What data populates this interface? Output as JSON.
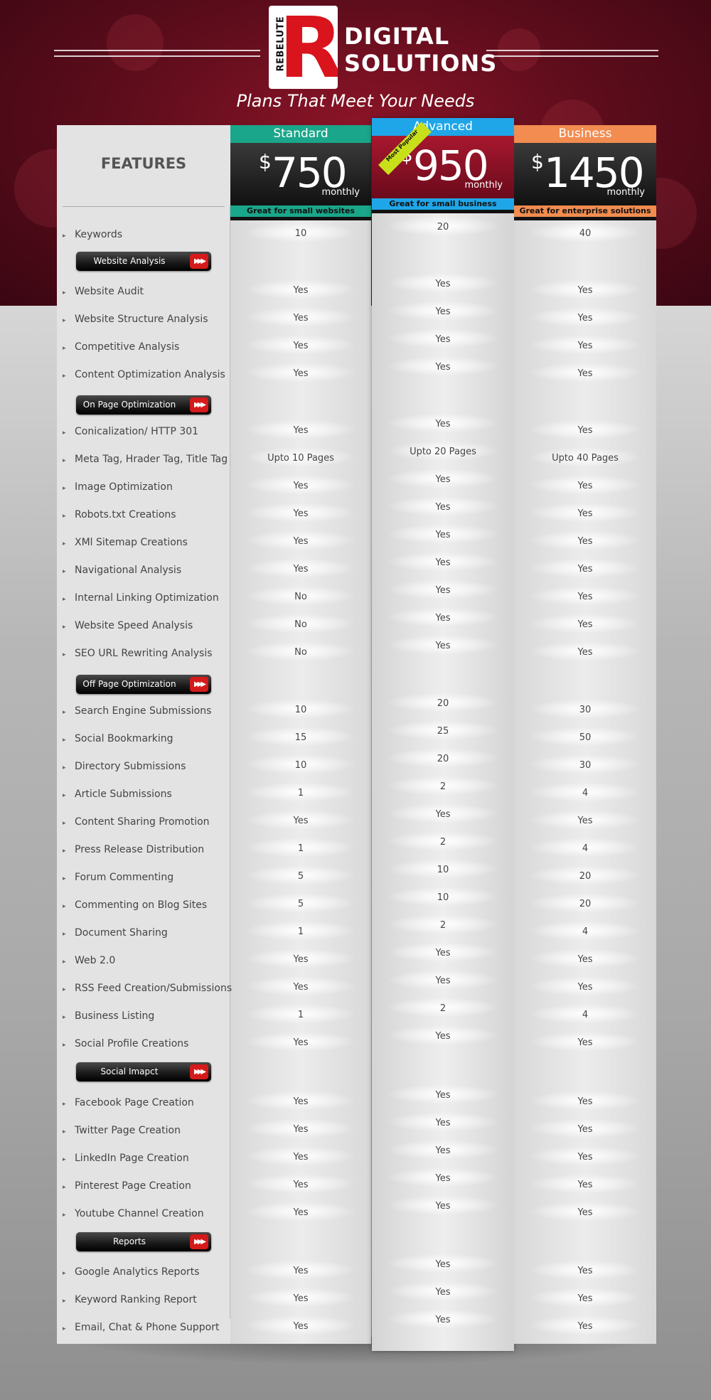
{
  "brand": {
    "logo_letter": "R",
    "logo_word": "REBELUTE",
    "line1": "DIGITAL",
    "line2": "SOLUTIONS",
    "tagline": "Plans That Meet Your Needs",
    "colors": {
      "maroon": "#6b0f1f",
      "logo_red": "#d9141c"
    }
  },
  "features_title": "FEATURES",
  "ribbon_label": "Most Popular",
  "plans": [
    {
      "name": "Standard",
      "currency": "$",
      "price": "750",
      "period": "monthly",
      "desc": "Great for small websites",
      "header_color": "#1aa68a",
      "desc_color": "#1aa68a"
    },
    {
      "name": "Advanced",
      "currency": "$",
      "price": "950",
      "period": "monthly",
      "desc": "Great for small business",
      "header_color": "#1fa6e8",
      "desc_color": "#1fa6e8"
    },
    {
      "name": "Business",
      "currency": "$",
      "price": "1450",
      "period": "monthly",
      "desc": "Great for enterprise solutions",
      "header_color": "#f28c50",
      "desc_color": "#f28c50"
    }
  ],
  "sections": [
    {
      "label": "Website Analysis"
    },
    {
      "label": "On Page Optimization"
    },
    {
      "label": "Off Page Optimization"
    },
    {
      "label": "Social Imapct"
    },
    {
      "label": "Reports"
    }
  ],
  "rows": [
    {
      "label": "Keywords",
      "values": [
        "10",
        "20",
        "40"
      ]
    },
    {
      "label": "Website Audit",
      "values": [
        "Yes",
        "Yes",
        "Yes"
      ]
    },
    {
      "label": "Website Structure Analysis",
      "values": [
        "Yes",
        "Yes",
        "Yes"
      ]
    },
    {
      "label": "Competitive Analysis",
      "values": [
        "Yes",
        "Yes",
        "Yes"
      ]
    },
    {
      "label": "Content Optimization Analysis",
      "values": [
        "Yes",
        "Yes",
        "Yes"
      ]
    },
    {
      "label": "Conicalization/ HTTP 301",
      "values": [
        "Yes",
        "Yes",
        "Yes"
      ]
    },
    {
      "label": "Meta Tag, Hrader Tag, Title Tag",
      "values": [
        "Upto 10 Pages",
        "Upto 20 Pages",
        "Upto 40 Pages"
      ]
    },
    {
      "label": "Image Optimization",
      "values": [
        "Yes",
        "Yes",
        "Yes"
      ]
    },
    {
      "label": "Robots.txt Creations",
      "values": [
        "Yes",
        "Yes",
        "Yes"
      ]
    },
    {
      "label": "XMl Sitemap Creations",
      "values": [
        "Yes",
        "Yes",
        "Yes"
      ]
    },
    {
      "label": "Navigational Analysis",
      "values": [
        "Yes",
        "Yes",
        "Yes"
      ]
    },
    {
      "label": "Internal Linking Optimization",
      "values": [
        "No",
        "Yes",
        "Yes"
      ]
    },
    {
      "label": "Website Speed Analysis",
      "values": [
        "No",
        "Yes",
        "Yes"
      ]
    },
    {
      "label": "SEO URL Rewriting Analysis",
      "values": [
        "No",
        "Yes",
        "Yes"
      ]
    },
    {
      "label": "Search Engine Submissions",
      "values": [
        "10",
        "20",
        "30"
      ]
    },
    {
      "label": "Social Bookmarking",
      "values": [
        "15",
        "25",
        "50"
      ]
    },
    {
      "label": "Directory Submissions",
      "values": [
        "10",
        "20",
        "30"
      ]
    },
    {
      "label": "Article Submissions",
      "values": [
        "1",
        "2",
        "4"
      ]
    },
    {
      "label": "Content Sharing Promotion",
      "values": [
        "Yes",
        "Yes",
        "Yes"
      ]
    },
    {
      "label": "Press Release Distribution",
      "values": [
        "1",
        "2",
        "4"
      ]
    },
    {
      "label": "Forum Commenting",
      "values": [
        "5",
        "10",
        "20"
      ]
    },
    {
      "label": "Commenting on Blog Sites",
      "values": [
        "5",
        "10",
        "20"
      ]
    },
    {
      "label": "Document Sharing",
      "values": [
        "1",
        "2",
        "4"
      ]
    },
    {
      "label": "Web 2.0",
      "values": [
        "Yes",
        "Yes",
        "Yes"
      ]
    },
    {
      "label": "RSS Feed Creation/Submissions",
      "values": [
        "Yes",
        "Yes",
        "Yes"
      ]
    },
    {
      "label": "Business Listing",
      "values": [
        "1",
        "2",
        "4"
      ]
    },
    {
      "label": "Social Profile Creations",
      "values": [
        "Yes",
        "Yes",
        "Yes"
      ]
    },
    {
      "label": "Facebook Page Creation",
      "values": [
        "Yes",
        "Yes",
        "Yes"
      ]
    },
    {
      "label": "Twitter Page Creation",
      "values": [
        "Yes",
        "Yes",
        "Yes"
      ]
    },
    {
      "label": "LinkedIn Page Creation",
      "values": [
        "Yes",
        "Yes",
        "Yes"
      ]
    },
    {
      "label": "Pinterest Page Creation",
      "values": [
        "Yes",
        "Yes",
        "Yes"
      ]
    },
    {
      "label": "Youtube Channel Creation",
      "values": [
        "Yes",
        "Yes",
        "Yes"
      ]
    },
    {
      "label": "Google Analytics Reports",
      "values": [
        "Yes",
        "Yes",
        "Yes"
      ]
    },
    {
      "label": "Keyword Ranking Report",
      "values": [
        "Yes",
        "Yes",
        "Yes"
      ]
    },
    {
      "label": "Email, Chat & Phone Support",
      "values": [
        "Yes",
        "Yes",
        "Yes"
      ]
    }
  ]
}
